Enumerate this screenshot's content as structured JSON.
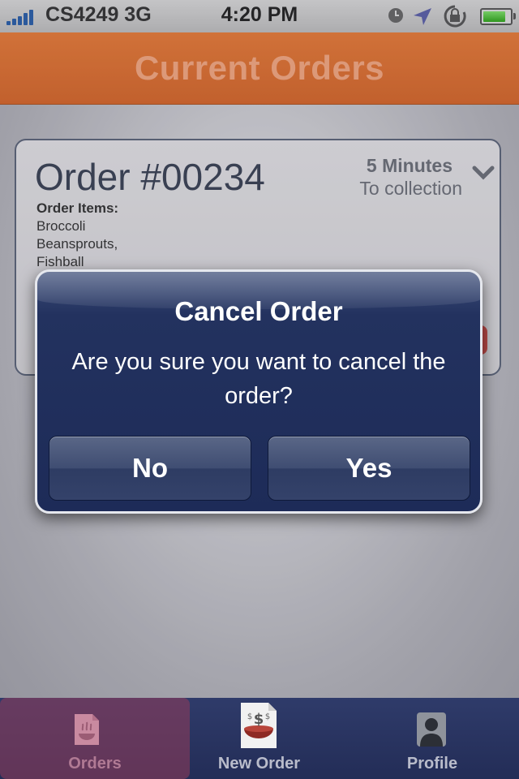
{
  "status_bar": {
    "carrier": "CS4249 3G",
    "time": "4:20 PM",
    "battery_level": 0.85
  },
  "header": {
    "title": "Current Orders"
  },
  "order": {
    "title": "Order #00234",
    "eta": "5 Minutes",
    "eta_label": "To collection",
    "items_label": "Order Items:",
    "items": [
      "Broccoli",
      "Beansprouts,",
      "Fishball"
    ]
  },
  "alert": {
    "title": "Cancel Order",
    "message": "Are you sure you want to cancel the order?",
    "no_label": "No",
    "yes_label": "Yes"
  },
  "tabs": [
    {
      "label": "Orders",
      "icon": "orders-icon",
      "active": true
    },
    {
      "label": "New Order",
      "icon": "new-order-icon",
      "active": false
    },
    {
      "label": "Profile",
      "icon": "profile-icon",
      "active": false
    }
  ],
  "colors": {
    "header_orange": "#e06f30",
    "alert_blue": "#23325f",
    "tab_active": "#b07a94"
  }
}
